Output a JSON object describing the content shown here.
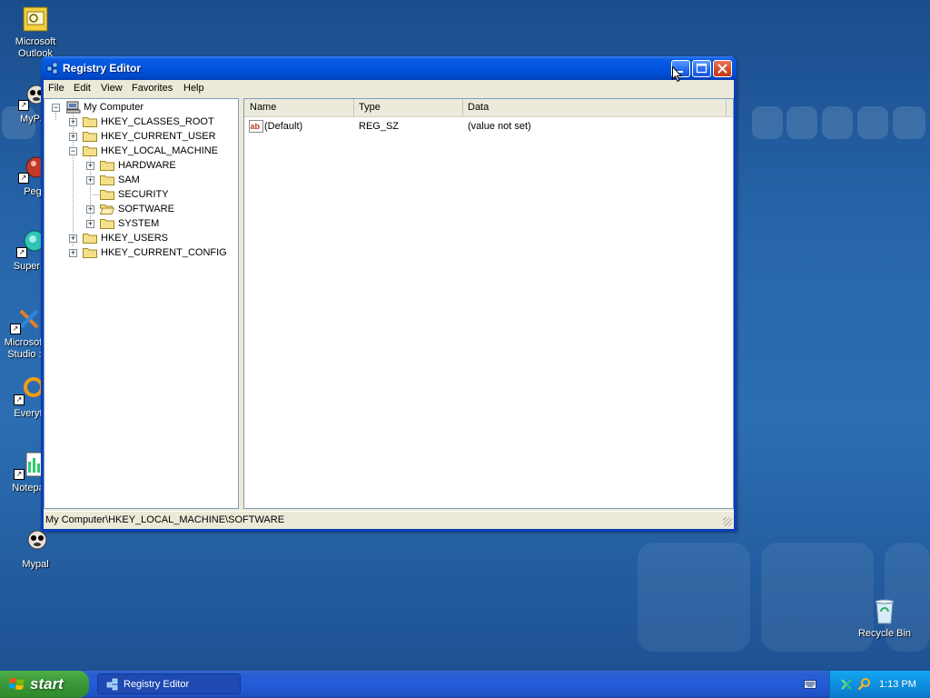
{
  "desktop": {
    "icons": [
      {
        "label": "Microsoft Outlook",
        "line1": "Microsoft",
        "line2": "Outlook"
      },
      {
        "label": "MyPa"
      },
      {
        "label": "Peg"
      },
      {
        "label": "Superm"
      },
      {
        "label": "Microsoft Studio",
        "line1": "Microsoft",
        "line2": "Studio :"
      },
      {
        "label": "Everyt"
      },
      {
        "label": "Notepa"
      },
      {
        "label": "Mypal"
      },
      {
        "label": "Recycle Bin"
      }
    ]
  },
  "window": {
    "title": "Registry Editor",
    "menu": [
      "File",
      "Edit",
      "View",
      "Favorites",
      "Help"
    ],
    "tree": [
      {
        "label": "My Computer",
        "expander": "−"
      },
      {
        "label": "HKEY_CLASSES_ROOT",
        "expander": "+"
      },
      {
        "label": "HKEY_CURRENT_USER",
        "expander": "+"
      },
      {
        "label": "HKEY_LOCAL_MACHINE",
        "expander": "−"
      },
      {
        "label": "HARDWARE",
        "expander": "+"
      },
      {
        "label": "SAM",
        "expander": "+"
      },
      {
        "label": "SECURITY",
        "expander": ""
      },
      {
        "label": "SOFTWARE",
        "expander": "+"
      },
      {
        "label": "SYSTEM",
        "expander": "+"
      },
      {
        "label": "HKEY_USERS",
        "expander": "+"
      },
      {
        "label": "HKEY_CURRENT_CONFIG",
        "expander": "+"
      }
    ],
    "list": {
      "columns": [
        "Name",
        "Type",
        "Data"
      ],
      "rows": [
        {
          "name": "(Default)",
          "type": "REG_SZ",
          "data": "(value not set)",
          "icon": "ab"
        }
      ]
    },
    "status": "My Computer\\HKEY_LOCAL_MACHINE\\SOFTWARE"
  },
  "taskbar": {
    "start_label": "start",
    "items": [
      {
        "label": "Registry Editor"
      }
    ],
    "clock": "1:13 PM"
  },
  "colors": {
    "desktop": "#2766ab",
    "titlebar": "#0053dd",
    "taskbar": "#245cd9",
    "start": "#3c9a3a",
    "tray": "#0f8fe0"
  }
}
